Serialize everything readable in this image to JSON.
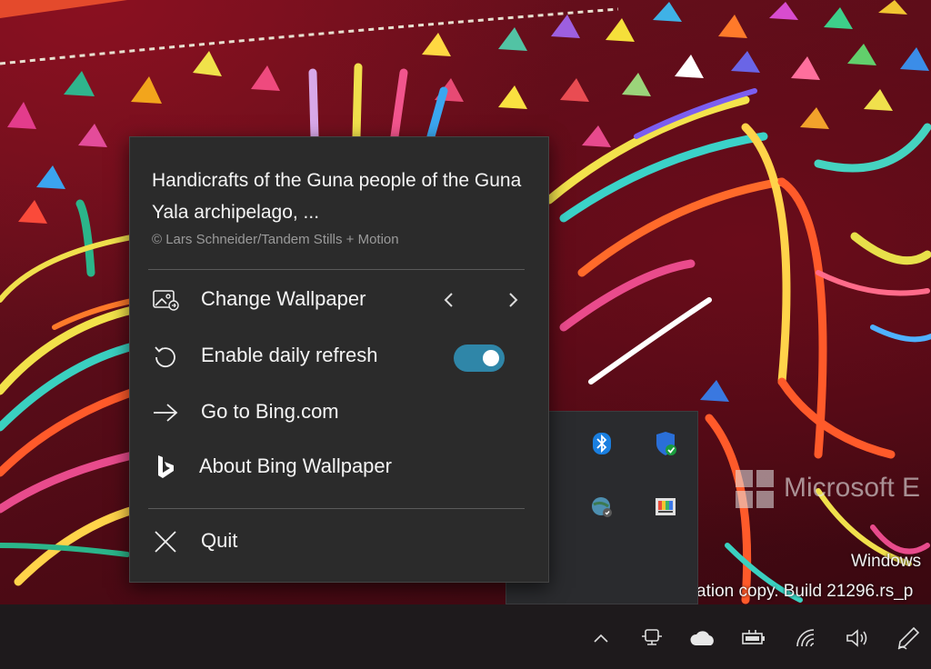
{
  "desktop": {
    "watermark_brand": "Microsoft E",
    "watermark_line1": "Windows",
    "watermark_line2": "ation copy. Build 21296.rs_p"
  },
  "menu": {
    "title": "Handicrafts of the Guna people of the Guna Yala archipelago, ...",
    "credit": "© Lars Schneider/Tandem Stills + Motion",
    "items": [
      {
        "label": "Change Wallpaper",
        "icon": "image-change-icon"
      },
      {
        "label": "Enable daily refresh",
        "icon": "refresh-icon",
        "toggle_on": true
      },
      {
        "label": "Go to Bing.com",
        "icon": "arrow-right-icon"
      },
      {
        "label": "About Bing Wallpaper",
        "icon": "bing-logo-icon"
      },
      {
        "label": "Quit",
        "icon": "close-icon"
      }
    ],
    "colors": {
      "toggle_on": "#2f86a8",
      "background": "#2b2b2b"
    }
  },
  "tray_popup": {
    "icons": [
      "bluetooth-icon",
      "windows-security-icon",
      "network-globe-icon",
      "color-app-icon"
    ]
  },
  "taskbar": {
    "icons": [
      "chevron-up-icon",
      "meet-now-icon",
      "onedrive-cloud-icon",
      "battery-icon",
      "wifi-icon",
      "volume-icon",
      "pen-icon"
    ]
  }
}
